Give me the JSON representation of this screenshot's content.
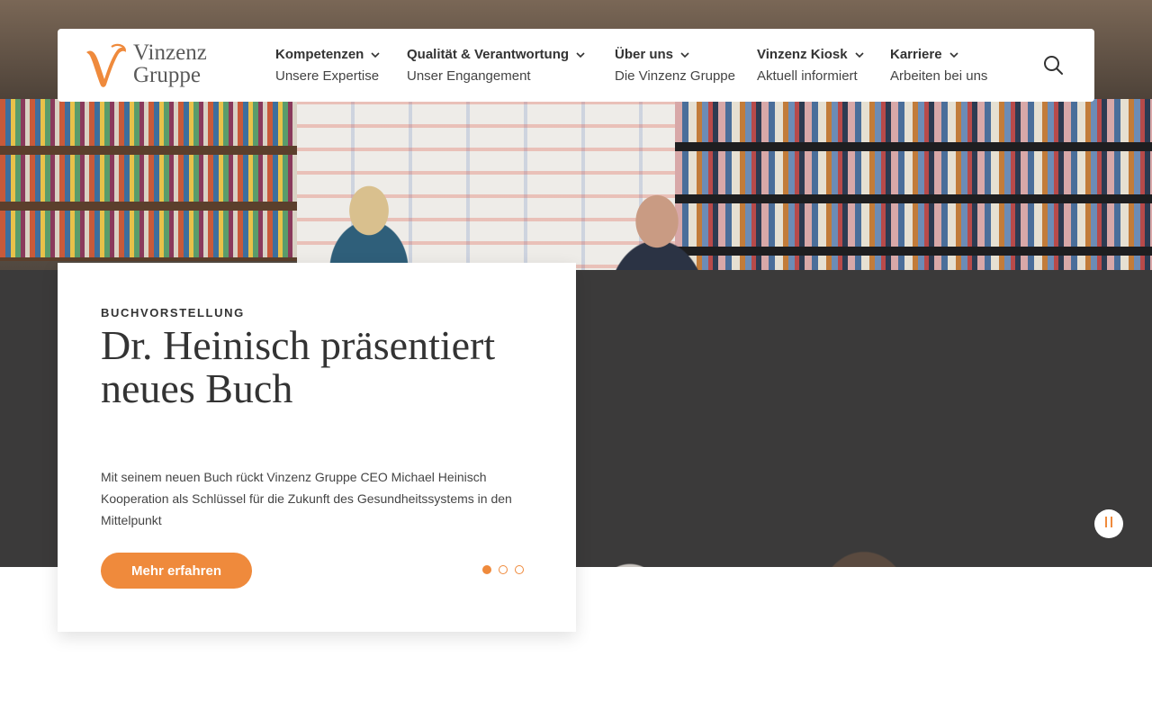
{
  "brand": {
    "name_line1": "Vinzenz",
    "name_line2": "Gruppe",
    "accent_color": "#ef8a3c"
  },
  "nav": {
    "items": [
      {
        "title": "Kompetenzen",
        "subtitle": "Unsere Expertise"
      },
      {
        "title": "Qualität & Verantwortung",
        "subtitle": "Unser Engangement"
      },
      {
        "title": "Über uns",
        "subtitle": "Die Vinzenz Gruppe"
      },
      {
        "title": "Vinzenz Kiosk",
        "subtitle": "Aktuell informiert"
      },
      {
        "title": "Karriere",
        "subtitle": "Arbeiten bei uns"
      }
    ],
    "search_icon": "search-icon",
    "chevron_icon": "chevron-down-icon"
  },
  "hero": {
    "image_alt": "book-presentation-photo",
    "eyebrow": "BUCHVORSTELLUNG",
    "headline": "Dr. Heinisch präsentiert neues Buch",
    "description": "Mit seinem neuen Buch rückt Vinzenz Gruppe CEO Michael Heinisch Kooperation als Schlüssel für die Zukunft des Gesundheitssystems in den Mittelpunkt",
    "cta_label": "Mehr erfahren",
    "slides_total": 3,
    "slide_active": 1,
    "pause_icon": "pause-icon"
  }
}
